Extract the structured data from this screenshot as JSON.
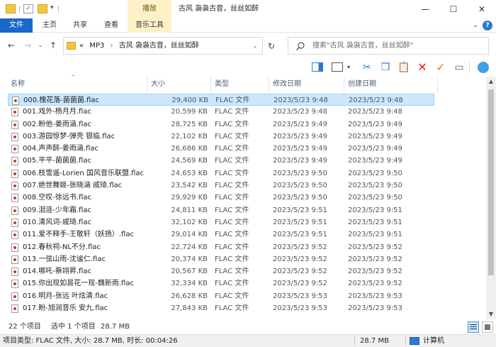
{
  "window": {
    "title": "古风 袅袅古音，丝丝如醉",
    "context_tab_header": "播放",
    "controls": {
      "minimize": "—",
      "maximize": "☐",
      "close": "✕"
    }
  },
  "ribbon": {
    "tabs": [
      "文件",
      "主页",
      "共享",
      "查看",
      "音乐工具"
    ],
    "help": "?"
  },
  "address": {
    "prefix": "«",
    "path": [
      "MP3",
      "古风 袅袅古音，丝丝如醉"
    ],
    "separator": "›"
  },
  "search": {
    "placeholder": "搜索\"古风 袅袅古音，丝丝如醉\""
  },
  "columns": [
    "名称",
    "大小",
    "类型",
    "修改日期",
    "创建日期"
  ],
  "files": [
    {
      "name": "000.槐花落-菌菌菌.flac",
      "size": "29,400 KB",
      "type": "FLAC 文件",
      "modified": "2023/5/23 9:48",
      "created": "2023/5/23 9:48",
      "selected": true
    },
    {
      "name": "001.戏外-杨月月.flac",
      "size": "20,599 KB",
      "type": "FLAC 文件",
      "modified": "2023/5/23 9:48",
      "created": "2023/5/23 9:48"
    },
    {
      "name": "002.盼他-姜雨涵.flac",
      "size": "28,725 KB",
      "type": "FLAC 文件",
      "modified": "2023/5/23 9:49",
      "created": "2023/5/23 9:49"
    },
    {
      "name": "003.游园惊梦-弹壳  银临.flac",
      "size": "22,102 KB",
      "type": "FLAC 文件",
      "modified": "2023/5/23 9:49",
      "created": "2023/5/23 9:49"
    },
    {
      "name": "004.声声醉-姜雨涵.flac",
      "size": "26,686 KB",
      "type": "FLAC 文件",
      "modified": "2023/5/23 9:49",
      "created": "2023/5/23 9:49"
    },
    {
      "name": "005.平平-菌菌菌.flac",
      "size": "24,569 KB",
      "type": "FLAC 文件",
      "modified": "2023/5/23 9:49",
      "created": "2023/5/23 9:49"
    },
    {
      "name": "006.枝雪遥-Lorien  国风音乐联盟.flac",
      "size": "24,653 KB",
      "type": "FLAC 文件",
      "modified": "2023/5/23 9:50",
      "created": "2023/5/23 9:50"
    },
    {
      "name": "007.绝世舞姬-张晓涵  戚琦.flac",
      "size": "23,542 KB",
      "type": "FLAC 文件",
      "modified": "2023/5/23 9:50",
      "created": "2023/5/23 9:50"
    },
    {
      "name": "008.空叹-徐远书.flac",
      "size": "29,929 KB",
      "type": "FLAC 文件",
      "modified": "2023/5/23 9:50",
      "created": "2023/5/23 9:50"
    },
    {
      "name": "009.泪涟-少年霜.flac",
      "size": "24,811 KB",
      "type": "FLAC 文件",
      "modified": "2023/5/23 9:51",
      "created": "2023/5/23 9:51"
    },
    {
      "name": "010.清风词-戚琦.flac",
      "size": "32,102 KB",
      "type": "FLAC 文件",
      "modified": "2023/5/23 9:51",
      "created": "2023/5/23 9:51"
    },
    {
      "name": "011.爱不释手-王敬轩（妖扬）.flac",
      "size": "29,014 KB",
      "type": "FLAC 文件",
      "modified": "2023/5/23 9:51",
      "created": "2023/5/23 9:51"
    },
    {
      "name": "012.春秋祠-NL不分.flac",
      "size": "22,724 KB",
      "type": "FLAC 文件",
      "modified": "2023/5/23 9:52",
      "created": "2023/5/23 9:52"
    },
    {
      "name": "013.一弦山雨-沈谧仁.flac",
      "size": "20,374 KB",
      "type": "FLAC 文件",
      "modified": "2023/5/23 9:52",
      "created": "2023/5/23 9:52"
    },
    {
      "name": "014.哪吒-蔡翊昇.flac",
      "size": "20,567 KB",
      "type": "FLAC 文件",
      "modified": "2023/5/23 9:52",
      "created": "2023/5/23 9:52"
    },
    {
      "name": "015.你出现如昙花一现-魏新雨.flac",
      "size": "32,334 KB",
      "type": "FLAC 文件",
      "modified": "2023/5/23 9:52",
      "created": "2023/5/23 9:52"
    },
    {
      "name": "016.明月-张远  叶炫清.flac",
      "size": "26,628 KB",
      "type": "FLAC 文件",
      "modified": "2023/5/23 9:53",
      "created": "2023/5/23 9:53"
    },
    {
      "name": "017.盼-旭润音乐  安九.flac",
      "size": "27,843 KB",
      "type": "FLAC 文件",
      "modified": "2023/5/23 9:53",
      "created": "2023/5/23 9:53"
    }
  ],
  "status": {
    "item_count": "22 个项目",
    "selected": "选中 1 个项目",
    "selected_size": "28.7 MB"
  },
  "details_bar": {
    "info": "项目类型: FLAC 文件, 大小: 28.7 MB, 时长: 00:04:26",
    "size": "28.7 MB",
    "location": "计算机"
  },
  "colors": {
    "accent": "#1a68c9",
    "selection": "#cce8ff",
    "context_tab": "#fdf2c7"
  }
}
